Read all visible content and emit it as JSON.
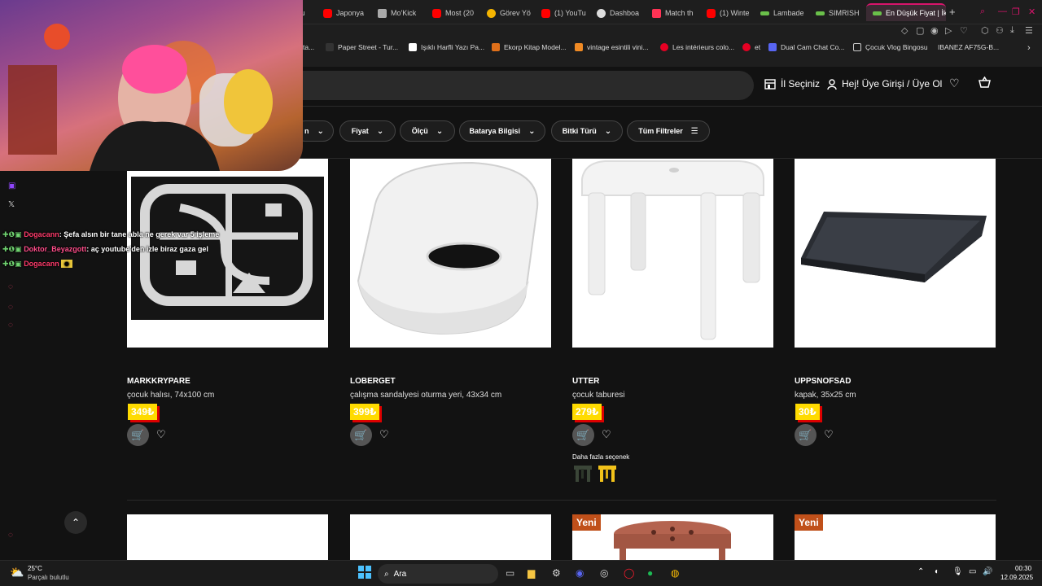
{
  "browser": {
    "tabs": [
      {
        "label": "ucu",
        "color": "#e04a3f"
      },
      {
        "label": "Japonya",
        "color": "#ff0000"
      },
      {
        "label": "Mo'Kick",
        "color": "#aaaaaa"
      },
      {
        "label": "Most (20",
        "color": "#ff0000"
      },
      {
        "label": "Görev Yö",
        "color": "#f4b400"
      },
      {
        "label": "(1) YouTu",
        "color": "#ff0000"
      },
      {
        "label": "Dashboa",
        "color": "#dddddd"
      },
      {
        "label": "Match th",
        "color": "#ff3355"
      },
      {
        "label": "(1) Winte",
        "color": "#ff0000"
      },
      {
        "label": "Lambade",
        "color": "#6ac04a"
      },
      {
        "label": "SIMRISH",
        "color": "#6ac04a"
      }
    ],
    "active_tab": "En Düşük Fiyat | İk",
    "bookmarks": [
      {
        "label": "ta...",
        "color": "#888888"
      },
      {
        "label": "Paper Street - Tur...",
        "color": "#333333"
      },
      {
        "label": "Işıklı Harfli Yazı Pa...",
        "color": "#ffffff"
      },
      {
        "label": "Ekorp Kitap Model...",
        "color": "#e0701a"
      },
      {
        "label": "vintage esintili vini...",
        "color": "#f08a24"
      },
      {
        "label": "Les intérieurs colo...",
        "color": "#e60023"
      },
      {
        "label": "et",
        "color": "#e60023"
      },
      {
        "label": "Dual Cam Chat Co...",
        "color": "#5865f2"
      },
      {
        "label": "Çocuk Vlog Bingosu",
        "color": "#cccccc"
      },
      {
        "label": "IBANEZ AF75G-B...",
        "color": "#333333"
      }
    ]
  },
  "header": {
    "city": "İl Seçiniz",
    "login": "Hej! Üye Girişi / Üye Ol"
  },
  "filters": [
    "n",
    "Fiyat",
    "Ölçü",
    "Batarya Bilgisi",
    "Bitki Türü",
    "Tüm Filtreler"
  ],
  "products": [
    {
      "name": "MARKKRYPARE",
      "desc": "çocuk halısı, 74x100 cm",
      "price": "349₺"
    },
    {
      "name": "LOBERGET",
      "desc": "çalışma sandalyesi oturma yeri, 43x34 cm",
      "price": "399₺"
    },
    {
      "name": "UTTER",
      "desc": "çocuk taburesi",
      "price": "279₺",
      "more": "Daha fazla seçenek"
    },
    {
      "name": "UPPSNOFSAD",
      "desc": "kapak, 35x25 cm",
      "price": "30₺"
    }
  ],
  "badges": {
    "new": "Yeni"
  },
  "stream_chat": [
    {
      "user": "Dogacann",
      "msg": ": Şefa alsın bir tane abla ne gerek var 5 işleme"
    },
    {
      "user": "Doktor_Beyazgott",
      "msg": ": aç youtube'den izle biraz gaza gel"
    },
    {
      "user": "Dogacann",
      "msg": ""
    }
  ],
  "taskbar": {
    "temp": "25°C",
    "weather": "Parçalı bulutlu",
    "search": "Ara",
    "time": "00:30",
    "date": "12.09.2025"
  }
}
